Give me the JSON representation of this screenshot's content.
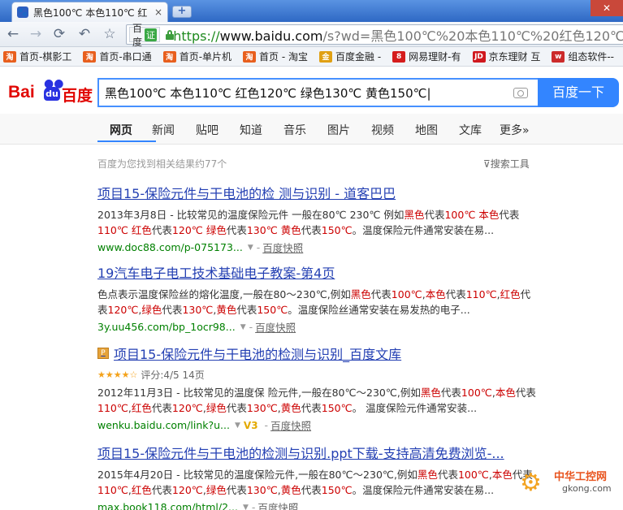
{
  "tab": {
    "title": "黑色100℃ 本色110℃ 红",
    "close": "×",
    "newtab": "+"
  },
  "window": {
    "close": "✕"
  },
  "toolbar": {
    "back": "←",
    "forward": "→",
    "reload": "⟳",
    "undo": "↶",
    "star": "☆",
    "badge_text": "百度",
    "badge_verified": "证",
    "url_scheme": "https://",
    "url_host": "www.baidu.com",
    "url_rest": "/s?wd=黑色100℃%20本色110℃%20红色120℃"
  },
  "bookmarks": [
    {
      "icon": "淘",
      "color": "#e85f1e",
      "label": "首页-棋影工"
    },
    {
      "icon": "淘",
      "color": "#e85f1e",
      "label": "首页-串口通"
    },
    {
      "icon": "淘",
      "color": "#e85f1e",
      "label": "首页-单片机"
    },
    {
      "icon": "淘",
      "color": "#e85f1e",
      "label": "首页 - 淘宝"
    },
    {
      "icon": "金",
      "color": "#e0a013",
      "label": "百度金融 -"
    },
    {
      "icon": "8",
      "color": "#d51c1c",
      "label": "网易理财-有"
    },
    {
      "icon": "JD",
      "color": "#d0181e",
      "label": "京东理财 互"
    },
    {
      "icon": "w",
      "color": "#cc2b2b",
      "label": "组态软件--"
    }
  ],
  "search": {
    "query": "黑色100℃ 本色110℃ 红色120℃ 绿色130℃ 黄色150℃|",
    "button": "百度一下"
  },
  "logo": {
    "bai": "Bai",
    "du": "du",
    "cn": "百度",
    "paw": "❚"
  },
  "navtabs": [
    "网页",
    "新闻",
    "贴吧",
    "知道",
    "音乐",
    "图片",
    "视频",
    "地图",
    "文库",
    "更多»"
  ],
  "result_count": "百度为您找到相关结果约77个",
  "tools": "搜索工具",
  "results": [
    {
      "title": "项目15-保险元件与干电池的检 测与识别 - 道客巴巴",
      "abstract": [
        {
          "t": "2013年3月8日 - 比较常见的温度保险元件 一般在80℃ 230℃ 例如"
        },
        {
          "t": "黑色",
          "hl": true
        },
        {
          "t": "代表"
        },
        {
          "t": "100℃",
          "hl": true
        },
        {
          "t": " "
        },
        {
          "t": "本色",
          "hl": true
        },
        {
          "t": "代表 "
        },
        {
          "t": "110℃",
          "hl": true
        },
        {
          "t": " "
        },
        {
          "t": "红色",
          "hl": true
        },
        {
          "t": "代表"
        },
        {
          "t": "120℃",
          "hl": true
        },
        {
          "t": " "
        },
        {
          "t": "绿色",
          "hl": true
        },
        {
          "t": "代表"
        },
        {
          "t": "130℃",
          "hl": true
        },
        {
          "t": " "
        },
        {
          "t": "黄色",
          "hl": true
        },
        {
          "t": "代表"
        },
        {
          "t": "150℃",
          "hl": true
        },
        {
          "t": "。温度保险元件通常安装在易..."
        }
      ],
      "url": "www.doc88.com/p-075173...",
      "snap": "百度快照"
    },
    {
      "title": "19汽车电子电工技术基础电子教案-第4页",
      "abstract": [
        {
          "t": "色点表示温度保险丝的熔化温度,一般在80～230℃,例如"
        },
        {
          "t": "黑色",
          "hl": true
        },
        {
          "t": "代表"
        },
        {
          "t": "100℃",
          "hl": true
        },
        {
          "t": ","
        },
        {
          "t": "本色",
          "hl": true
        },
        {
          "t": "代表"
        },
        {
          "t": "110℃",
          "hl": true
        },
        {
          "t": ","
        },
        {
          "t": "红色",
          "hl": true
        },
        {
          "t": "代表"
        },
        {
          "t": "120℃",
          "hl": true
        },
        {
          "t": ","
        },
        {
          "t": "绿色",
          "hl": true
        },
        {
          "t": "代表"
        },
        {
          "t": "130℃",
          "hl": true
        },
        {
          "t": ","
        },
        {
          "t": "黄色",
          "hl": true
        },
        {
          "t": "代表"
        },
        {
          "t": "150℃",
          "hl": true
        },
        {
          "t": "。温度保险丝通常安装在易发热的电子..."
        }
      ],
      "url": "3y.uu456.com/bp_1ocr98...",
      "snap": "百度快照"
    },
    {
      "title": "项目15-保险元件与干电池的检测与识别_百度文库",
      "badge": "P",
      "stars": "★★★★☆",
      "rating": "评分:4/5 14页",
      "abstract": [
        {
          "t": "2012年11月3日 - 比较常见的温度保 险元件,一般在80℃～230℃,例如"
        },
        {
          "t": "黑色",
          "hl": true
        },
        {
          "t": "代表"
        },
        {
          "t": "100℃",
          "hl": true
        },
        {
          "t": ","
        },
        {
          "t": "本色",
          "hl": true
        },
        {
          "t": "代表"
        },
        {
          "t": "110℃",
          "hl": true
        },
        {
          "t": ","
        },
        {
          "t": "红色",
          "hl": true
        },
        {
          "t": "代表"
        },
        {
          "t": "120℃",
          "hl": true
        },
        {
          "t": ","
        },
        {
          "t": "绿色",
          "hl": true
        },
        {
          "t": "代表"
        },
        {
          "t": "130℃",
          "hl": true
        },
        {
          "t": ","
        },
        {
          "t": "黄色",
          "hl": true
        },
        {
          "t": "代表"
        },
        {
          "t": "150℃",
          "hl": true
        },
        {
          "t": "。 温度保险元件通常安装..."
        }
      ],
      "url": "wenku.baidu.com/link?u...",
      "v": "V3",
      "snap": "百度快照"
    },
    {
      "title": "项目15-保险元件与干电池的检测与识别.ppt下载-支持高清免费浏览-...",
      "abstract": [
        {
          "t": "2015年4月20日 - 比较常见的温度保险元件,一般在80℃～230℃,例如"
        },
        {
          "t": "黑色",
          "hl": true
        },
        {
          "t": "代表"
        },
        {
          "t": "100℃",
          "hl": true
        },
        {
          "t": ","
        },
        {
          "t": "本色",
          "hl": true
        },
        {
          "t": "代表"
        },
        {
          "t": "110℃",
          "hl": true
        },
        {
          "t": ","
        },
        {
          "t": "红色",
          "hl": true
        },
        {
          "t": "代表"
        },
        {
          "t": "120℃",
          "hl": true
        },
        {
          "t": ","
        },
        {
          "t": "绿色",
          "hl": true
        },
        {
          "t": "代表"
        },
        {
          "t": "130℃",
          "hl": true
        },
        {
          "t": ","
        },
        {
          "t": "黄色",
          "hl": true
        },
        {
          "t": "代表"
        },
        {
          "t": "150℃",
          "hl": true
        },
        {
          "t": "。温度保险元件通常安装在易..."
        }
      ],
      "url": "max.book118.com/html/2...",
      "snap": "百度快照"
    }
  ],
  "watermark": {
    "cn": "中华工控网",
    "en": "gkong.com"
  }
}
